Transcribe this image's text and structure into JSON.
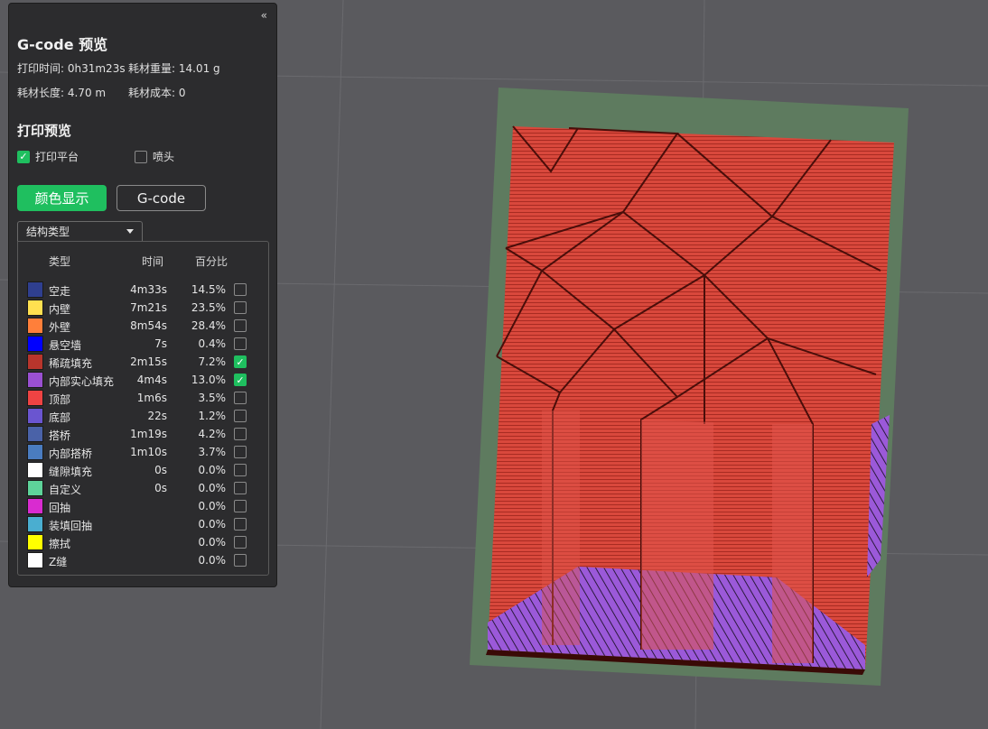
{
  "panel": {
    "collapse_icon": "«",
    "title": "G-code 预览",
    "stats": {
      "print_time": "打印时间: 0h31m23s",
      "filament_weight": "耗材重量: 14.01 g",
      "filament_length": "耗材长度: 4.70 m",
      "filament_cost": "耗材成本: 0"
    },
    "preview_section": "打印预览",
    "checkboxes": [
      {
        "label": "打印平台",
        "checked": true
      },
      {
        "label": "喷头",
        "checked": false
      }
    ],
    "buttons": {
      "color": "颜色显示",
      "gcode": "G-code"
    },
    "dropdown": {
      "selected": "结构类型"
    },
    "legend": {
      "headers": {
        "type": "类型",
        "time": "时间",
        "percent": "百分比"
      },
      "rows": [
        {
          "name": "空走",
          "time": "4m33s",
          "pct": "14.5%",
          "color": "#2f3f8f",
          "checked": false
        },
        {
          "name": "内壁",
          "time": "7m21s",
          "pct": "23.5%",
          "color": "#ffe050",
          "checked": false
        },
        {
          "name": "外壁",
          "time": "8m54s",
          "pct": "28.4%",
          "color": "#ff7f3a",
          "checked": false
        },
        {
          "name": "悬空墙",
          "time": "7s",
          "pct": "0.4%",
          "color": "#0000ff",
          "checked": false
        },
        {
          "name": "稀疏填充",
          "time": "2m15s",
          "pct": "7.2%",
          "color": "#b8352c",
          "checked": true
        },
        {
          "name": "内部实心填充",
          "time": "4m4s",
          "pct": "13.0%",
          "color": "#9a50d2",
          "checked": true
        },
        {
          "name": "顶部",
          "time": "1m6s",
          "pct": "3.5%",
          "color": "#ef4343",
          "checked": false
        },
        {
          "name": "底部",
          "time": "22s",
          "pct": "1.2%",
          "color": "#6a55d0",
          "checked": false
        },
        {
          "name": "搭桥",
          "time": "1m19s",
          "pct": "4.2%",
          "color": "#4a62a8",
          "checked": false
        },
        {
          "name": "内部搭桥",
          "time": "1m10s",
          "pct": "3.7%",
          "color": "#4a7cc0",
          "checked": false
        },
        {
          "name": "缝隙填充",
          "time": "0s",
          "pct": "0.0%",
          "color": "#ffffff",
          "checked": false
        },
        {
          "name": "自定义",
          "time": "0s",
          "pct": "0.0%",
          "color": "#5ed39a",
          "checked": false
        },
        {
          "name": "回抽",
          "time": "",
          "pct": "0.0%",
          "color": "#d92bd0",
          "checked": false
        },
        {
          "name": "装填回抽",
          "time": "",
          "pct": "0.0%",
          "color": "#4aaed0",
          "checked": false
        },
        {
          "name": "擦拭",
          "time": "",
          "pct": "0.0%",
          "color": "#ffff00",
          "checked": false
        },
        {
          "name": "Z缝",
          "time": "",
          "pct": "0.0%",
          "color": "#ffffff",
          "checked": false
        }
      ]
    }
  }
}
